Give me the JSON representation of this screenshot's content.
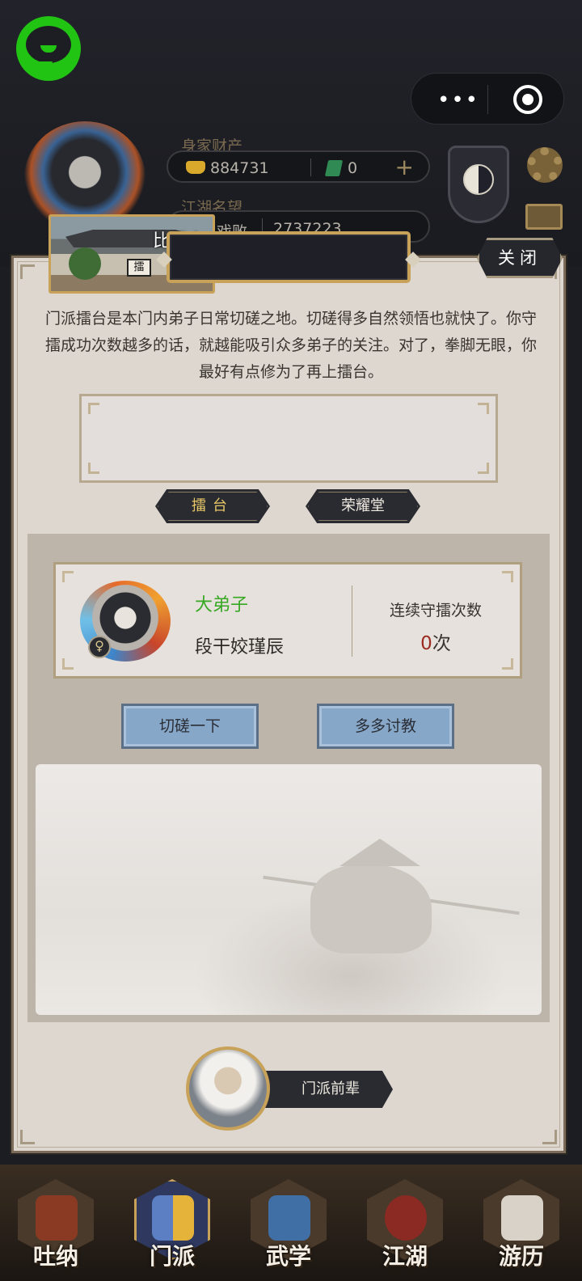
{
  "header": {
    "wealth_label": "身家财产",
    "gold_amount": "884731",
    "jade_amount": "0",
    "plus_symbol": "+",
    "reputation_label": "江湖名望",
    "reputation_partial": "戏败",
    "reputation_value": "2737223"
  },
  "capsule": {
    "menu_glyph": "•••"
  },
  "modal": {
    "thumb_label": "比武台",
    "thumb_plaque": "擂",
    "close_label": "关闭",
    "intro_text": "门派擂台是本门内弟子日常切磋之地。切磋得多自然领悟也就快了。你守擂成功次数越多的话，就越能吸引众多弟子的关注。对了，拳脚无眼，你最好有点修为了再上擂台。",
    "tabs": [
      {
        "label": "擂台"
      },
      {
        "label": "荣耀堂"
      }
    ]
  },
  "champion": {
    "title": "大弟子",
    "name": "段干姣瑾辰",
    "gender_symbol": "♀",
    "streak_label": "连续守擂次数",
    "streak_count": "0",
    "streak_unit": "次"
  },
  "actions": {
    "spar_label": "切磋一下",
    "learn_label": "多多讨教"
  },
  "elder": {
    "label": "门派前辈"
  },
  "bottom_nav": [
    {
      "label": "吐纳",
      "active": false
    },
    {
      "label": "门派",
      "active": true
    },
    {
      "label": "武学",
      "active": false
    },
    {
      "label": "江湖",
      "active": false
    },
    {
      "label": "游历",
      "active": false
    }
  ],
  "colors": {
    "champion_title": "#36a822",
    "streak_number": "#9b2a1f",
    "gold_trim": "#c9a25a",
    "action_button": "#87a7c8"
  }
}
